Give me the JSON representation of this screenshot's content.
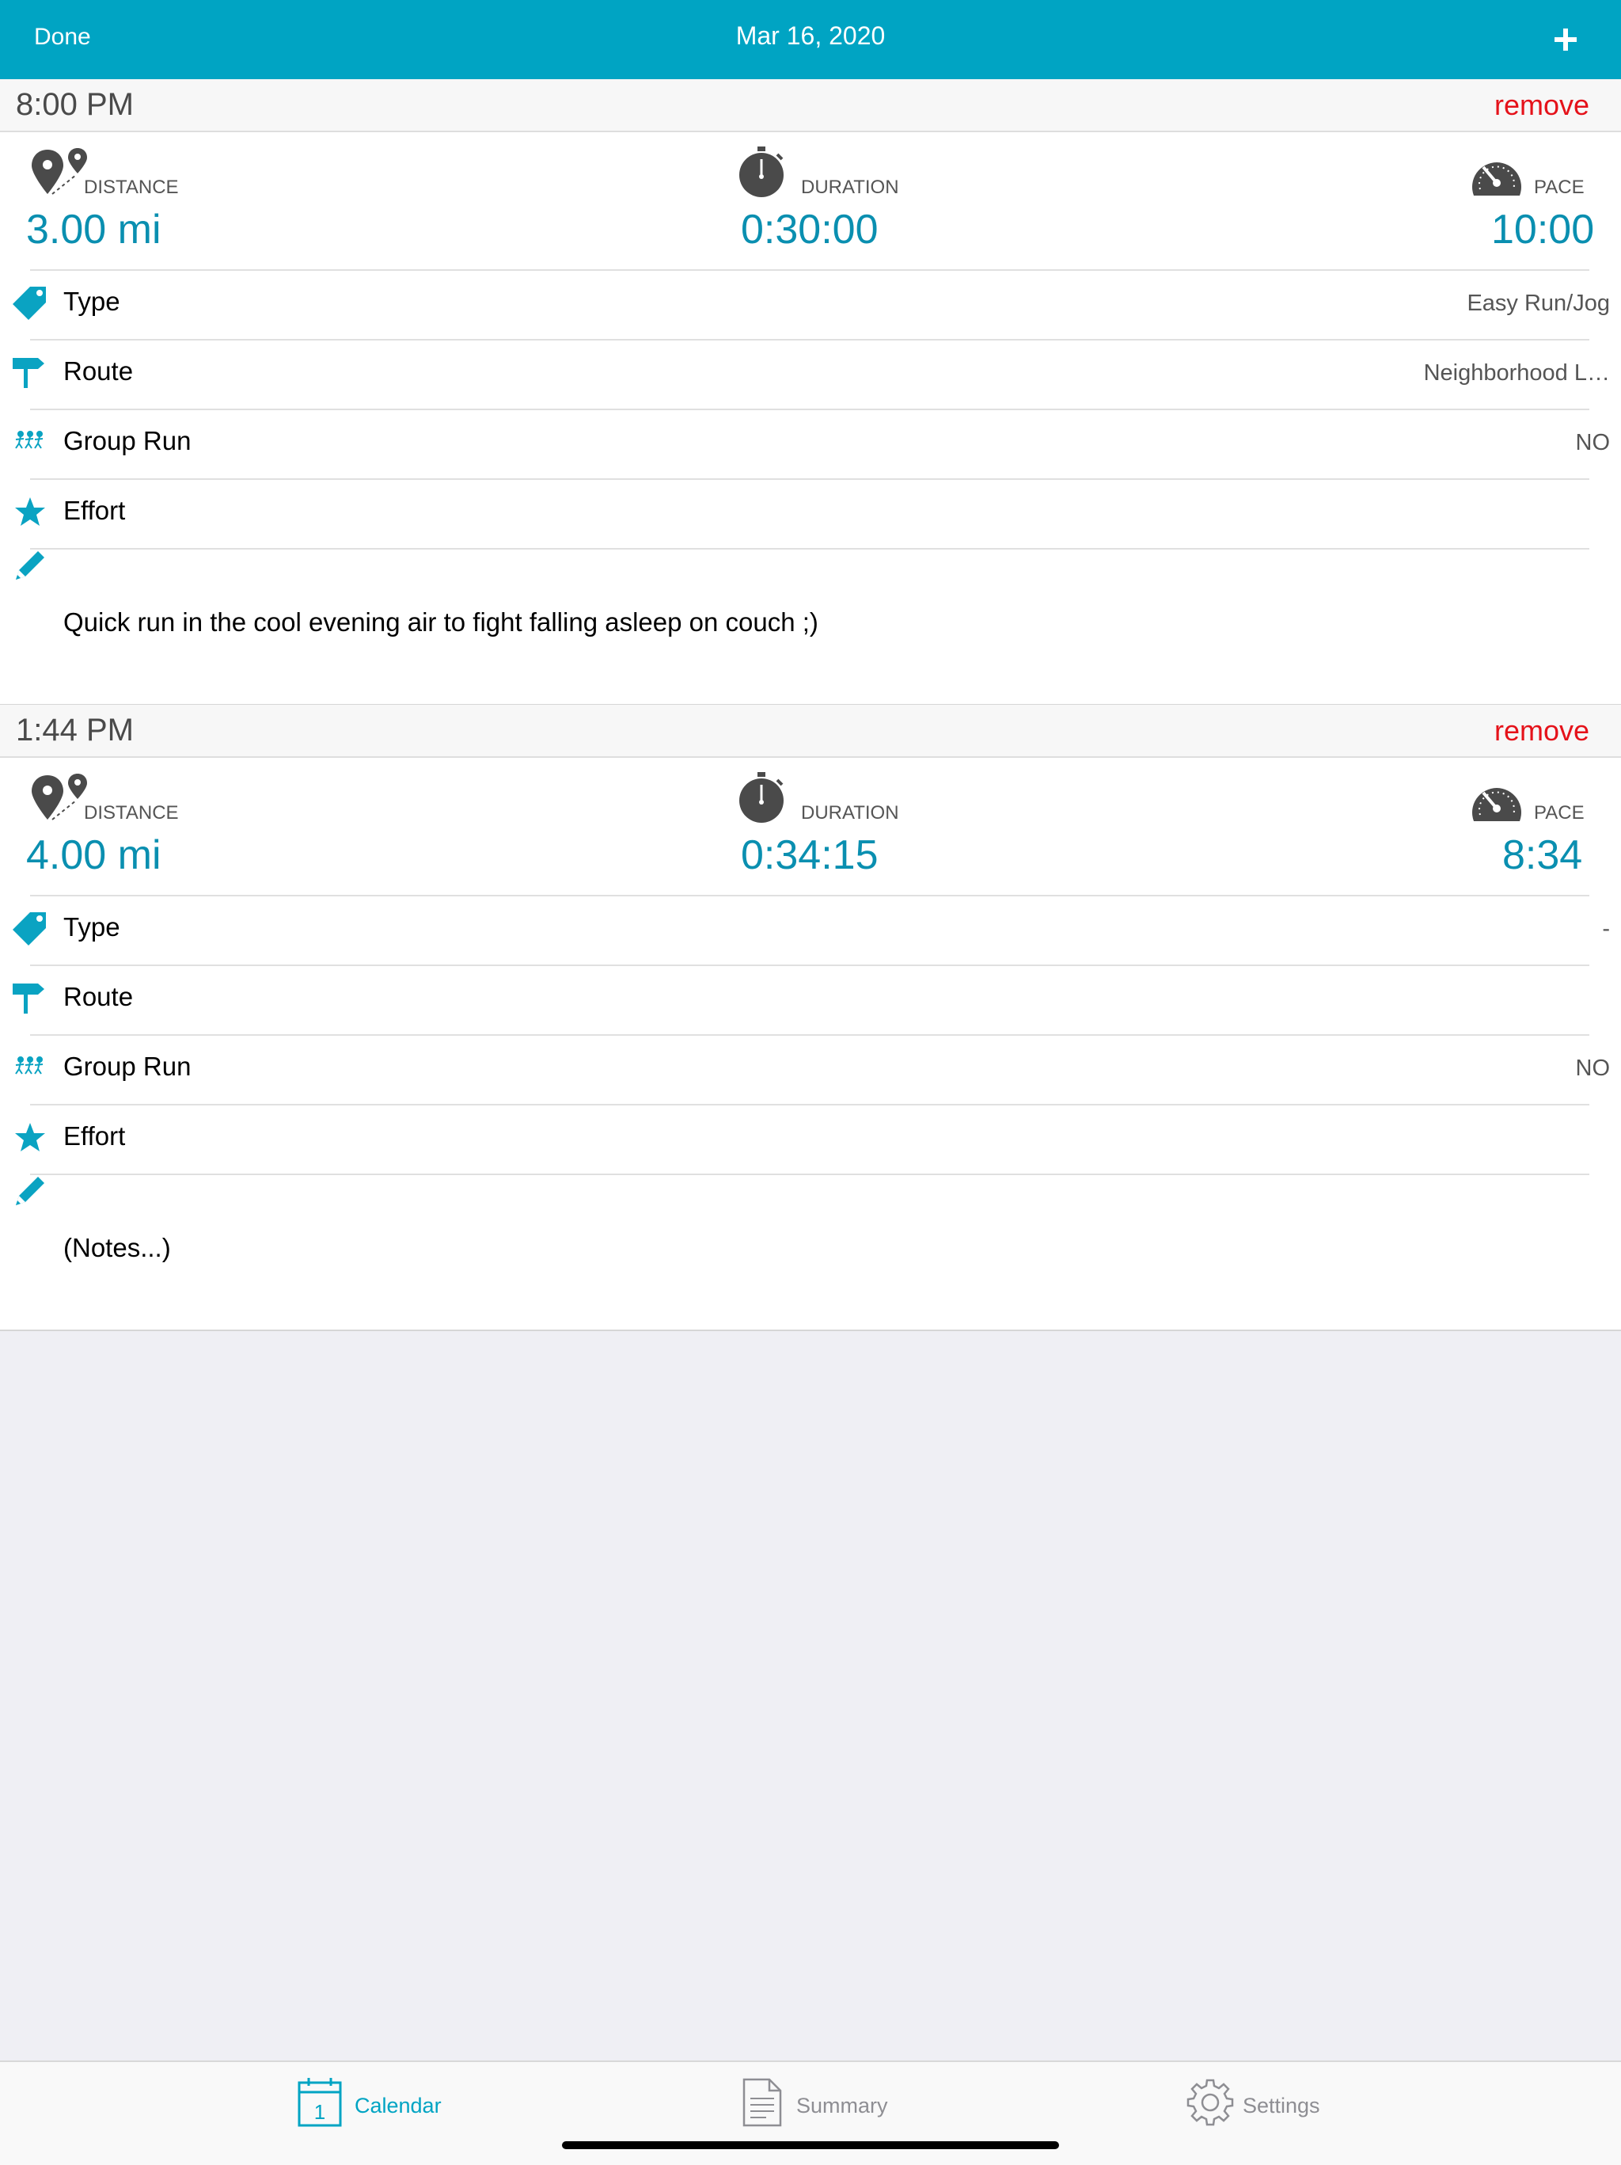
{
  "colors": {
    "accent": "#00a4c3",
    "value": "#0a8fb0",
    "remove": "#e5121a",
    "icon_gray": "#4a4a4a"
  },
  "navbar": {
    "done_label": "Done",
    "title": "Mar 16, 2020",
    "add_icon": "plus-icon"
  },
  "workouts": [
    {
      "time": "8:00 PM",
      "remove_label": "remove",
      "stats": {
        "distance": {
          "label": "DISTANCE",
          "value": "3.00 mi",
          "icon": "map-pins-icon"
        },
        "duration": {
          "label": "DURATION",
          "value": "0:30:00",
          "icon": "stopwatch-icon"
        },
        "pace": {
          "label": "PACE",
          "value": "10:00",
          "icon": "speedometer-icon"
        }
      },
      "rows": [
        {
          "label": "Type",
          "value": "Easy Run/Jog",
          "icon": "tag-icon"
        },
        {
          "label": "Route",
          "value": "Neighborhood L…",
          "icon": "signpost-icon"
        },
        {
          "label": "Group Run",
          "value": "NO",
          "icon": "runners-icon"
        },
        {
          "label": "Effort",
          "value": "",
          "icon": "star-icon"
        }
      ],
      "notes": "Quick run in the cool evening air to fight falling asleep on couch ;)"
    },
    {
      "time": "1:44 PM",
      "remove_label": "remove",
      "stats": {
        "distance": {
          "label": "DISTANCE",
          "value": "4.00 mi",
          "icon": "map-pins-icon"
        },
        "duration": {
          "label": "DURATION",
          "value": "0:34:15",
          "icon": "stopwatch-icon"
        },
        "pace": {
          "label": "PACE",
          "value": "8:34",
          "icon": "speedometer-icon"
        }
      },
      "rows": [
        {
          "label": "Type",
          "value": "-",
          "icon": "tag-icon"
        },
        {
          "label": "Route",
          "value": "",
          "icon": "signpost-icon"
        },
        {
          "label": "Group Run",
          "value": "NO",
          "icon": "runners-icon"
        },
        {
          "label": "Effort",
          "value": "",
          "icon": "star-icon"
        }
      ],
      "notes": "(Notes...)"
    }
  ],
  "tabbar": {
    "tabs": [
      {
        "label": "Calendar",
        "icon": "calendar-icon",
        "icon_text": "1",
        "active": true
      },
      {
        "label": "Summary",
        "icon": "document-icon",
        "active": false
      },
      {
        "label": "Settings",
        "icon": "gear-icon",
        "active": false
      }
    ]
  }
}
